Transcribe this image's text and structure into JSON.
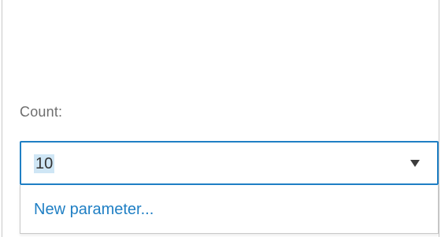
{
  "field": {
    "label": "Count:",
    "selected_value": "10"
  },
  "dropdown": {
    "options": [
      {
        "label": "New parameter..."
      }
    ]
  },
  "colors": {
    "accent": "#1f7fc4",
    "selection_highlight": "#cfe6f5",
    "label_text": "#6e6e6e"
  },
  "icons": {
    "dropdown_arrow": "chevron-down-icon"
  }
}
